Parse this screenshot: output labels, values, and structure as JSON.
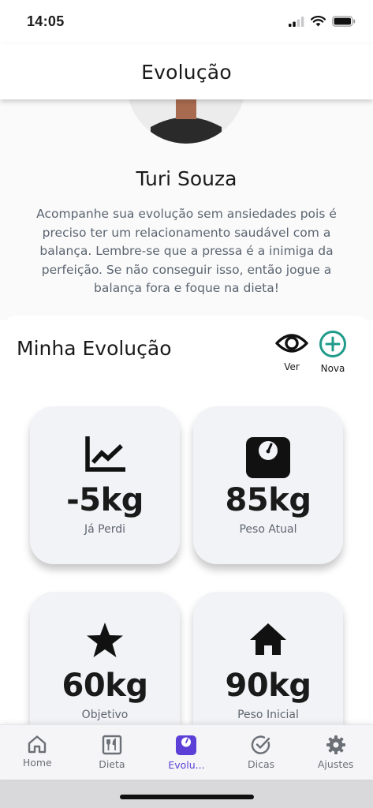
{
  "status_bar": {
    "time": "14:05"
  },
  "header": {
    "title": "Evolução"
  },
  "profile": {
    "name": "Turi Souza",
    "description": "Acompanhe sua evolução sem ansiedades pois é preciso ter um relacionamento saudável com a balança. Lembre-se que a pressa é a inimiga da perfeição. Se não conseguir isso, então jogue a balança fora e foque na dieta!"
  },
  "evolution": {
    "title": "Minha Evolução",
    "actions": {
      "ver_label": "Ver",
      "nova_label": "Nova"
    },
    "accent_color": "#1f9b8a",
    "cards": [
      {
        "icon": "trend-chart-icon",
        "value": "-5kg",
        "label": "Já Perdi"
      },
      {
        "icon": "scale-icon",
        "value": "85kg",
        "label": "Peso Atual"
      },
      {
        "icon": "star-icon",
        "value": "60kg",
        "label": "Objetivo"
      },
      {
        "icon": "house-icon",
        "value": "90kg",
        "label": "Peso Inicial"
      }
    ]
  },
  "bottom_nav": {
    "active_color": "#5b3fd6",
    "items": [
      {
        "icon": "home-icon",
        "label": "Home",
        "active": false
      },
      {
        "icon": "menu-cutlery-icon",
        "label": "Dieta",
        "active": false
      },
      {
        "icon": "scale-icon",
        "label": "Evolu...",
        "active": true
      },
      {
        "icon": "check-circle-icon",
        "label": "Dicas",
        "active": false
      },
      {
        "icon": "gear-icon",
        "label": "Ajustes",
        "active": false
      }
    ]
  }
}
